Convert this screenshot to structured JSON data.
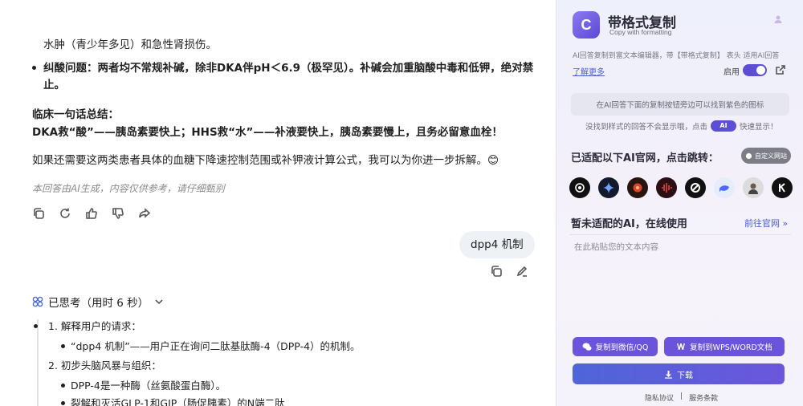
{
  "chat": {
    "lines": {
      "l1": "水肿（青少年多见）和急性肾损伤。",
      "l2": "纠酸问题：两者均不常规补碱，除非DKA伴pH＜6.9（极罕见）。补碱会加重脑酸中毒和低钾，绝对禁",
      "l3": "止。",
      "l4": "临床一句话总结：",
      "l5": "DKA救“酸”——胰岛素要快上；HHS救“水”——补液要快上，胰岛素要慢上，且务必留意血栓！",
      "l6": "如果还需要这两类患者具体的血糖下降速控制范围或补钾液计算公式，我可以为你进一步拆解。😊"
    },
    "disclaimer": "本回答由AI生成，内容仅供参考，请仔细甄别",
    "user_message": "dpp4 机制",
    "thinking": "已思考（用时 6 秒）",
    "thought": {
      "t1": "1. 解释用户的请求：",
      "t2": "“dpp4 机制”——用户正在询问二肽基肽酶-4（DPP-4）的机制。",
      "t3": "2. 初步头脑风暴与组织：",
      "t4": "DPP-4是一种酶（丝氨酸蛋白酶）。",
      "t5": "裂解和灭活GLP-1和GIP（肠促胰素）的N端二肽"
    }
  },
  "panel": {
    "title": "带格式复制",
    "subtitle": "Copy with formatting",
    "description": "AI回答复制到富文本编辑器，带【带格式复制】 表头 适用AI回答",
    "learn_more": "了解更多",
    "enable_label": "启用",
    "hint1": "在AI回答下面的复制按钮旁边可以找到紫色的图标",
    "hint2_pre": "没找到样式的回答不会显示哦，点击",
    "hint2_badge": "AI",
    "hint2_post": "快速显示！",
    "adapted_title": "已适配以下AI官网，点击跳转：",
    "custom_button": "自定义网站",
    "not_adapted_title": "暂未适配的AI，在线使用",
    "goto_site": "前往官网 »",
    "paste_placeholder": "在此粘贴您的文本内容",
    "btn_wechat": "复制到微信/QQ",
    "btn_wps": "复制到WPS/WORD文档",
    "btn_download": "下载",
    "footer_privacy": "隐私协议",
    "footer_sep": "|",
    "footer_terms": "服务条款"
  }
}
